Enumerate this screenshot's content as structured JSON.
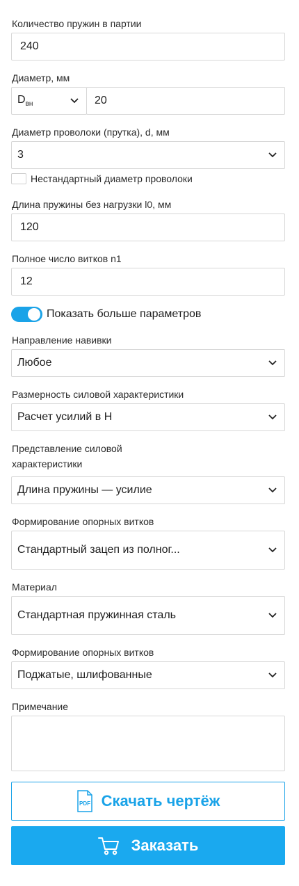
{
  "fields": {
    "quantity": {
      "label": "Количество пружин в партии",
      "value": "240"
    },
    "diameter": {
      "label": "Диаметр, мм",
      "type_main": "D",
      "type_sub": "вн",
      "value": "20"
    },
    "wire_diameter": {
      "label": "Диаметр проволоки (прутка), d, мм",
      "value": "3"
    },
    "nonstandard_wire": {
      "label": "Нестандартный диаметр проволоки",
      "checked": false
    },
    "free_length": {
      "label": "Длина пружины без нагрузки l0, мм",
      "value": "120"
    },
    "total_turns": {
      "label": "Полное число витков n1",
      "value": "12"
    }
  },
  "more_params_toggle": {
    "label": "Показать больше параметров",
    "on": true
  },
  "advanced": {
    "winding_direction": {
      "label": "Направление навивки",
      "value": "Любое"
    },
    "force_units": {
      "label": "Размерность силовой характеристики",
      "value": "Расчет усилий в Н"
    },
    "force_representation": {
      "label_line1": "Представление силовой",
      "label_line2": "характеристики",
      "value": "Длина пружины — усилие"
    },
    "support_turns": {
      "label": "Формирование опорных витков",
      "value": "Стандартный зацеп из полног..."
    },
    "material": {
      "label": "Материал",
      "value": "Стандартная пружинная сталь"
    },
    "support_turns_2": {
      "label": "Формирование опорных витков",
      "value": "Поджатые, шлифованные"
    },
    "note": {
      "label": "Примечание",
      "value": ""
    }
  },
  "buttons": {
    "download": {
      "label": "Скачать чертёж",
      "icon_text": "PDF"
    },
    "order": {
      "label": "Заказать"
    }
  },
  "colors": {
    "accent": "#1aa3e8",
    "border": "#d7d7d7"
  }
}
